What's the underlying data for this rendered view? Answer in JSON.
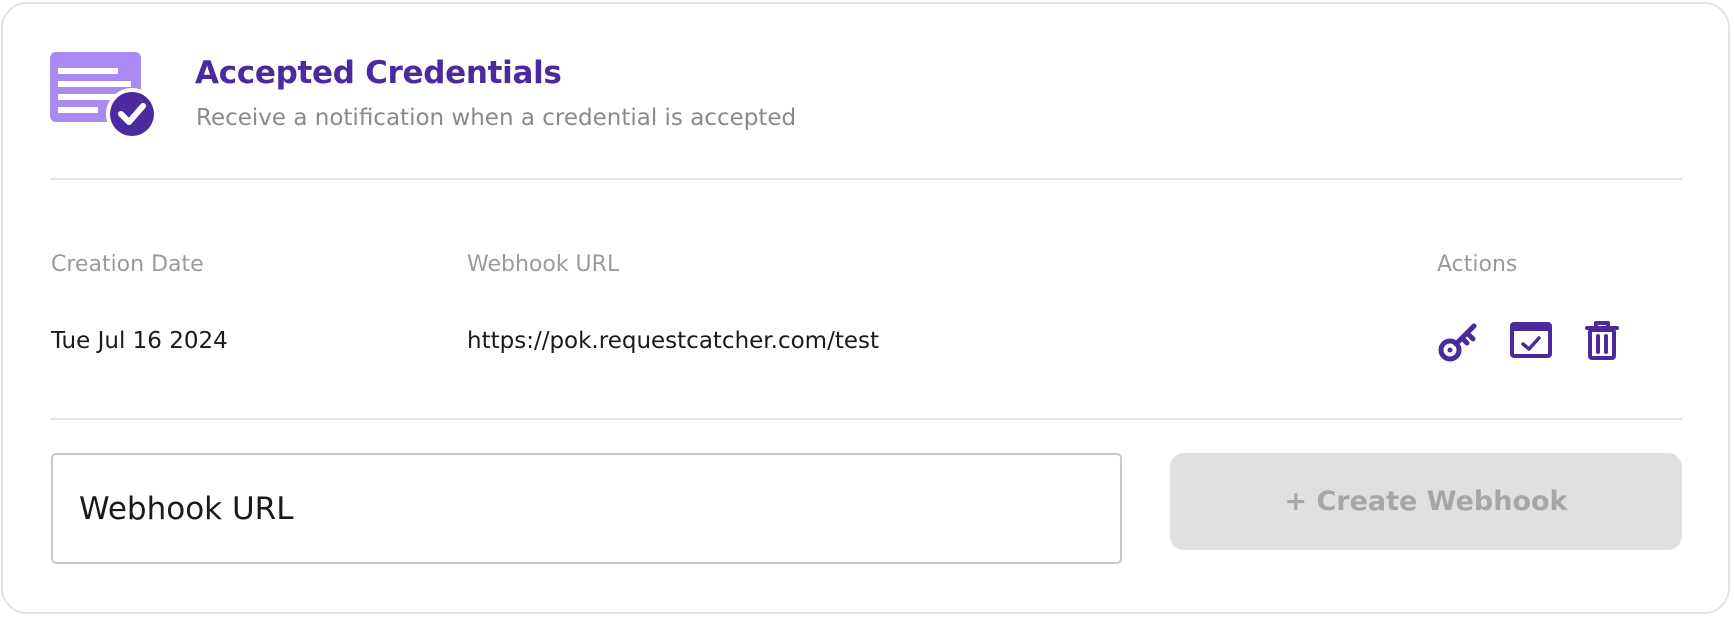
{
  "header": {
    "title": "Accepted Credentials",
    "subtitle": "Receive a notification when a credential is accepted",
    "icon": "credential-accepted-icon"
  },
  "table": {
    "columns": [
      "Creation Date",
      "Webhook URL",
      "Actions"
    ],
    "rows": [
      {
        "creation_date": "Tue Jul 16 2024",
        "webhook_url": "https://pok.requestcatcher.com/test",
        "actions": [
          "key-icon",
          "test-webhook-icon",
          "trash-icon"
        ]
      }
    ]
  },
  "form": {
    "input_placeholder": "Webhook URL",
    "input_value": "",
    "create_button_label": "+ Create Webhook",
    "create_button_disabled": true
  },
  "colors": {
    "accent": "#4b2a9e",
    "icon_light": "#a98af2",
    "muted_text": "#8a8a8e",
    "button_disabled_bg": "#e0e0e0",
    "button_disabled_text": "#a6a6a6"
  }
}
